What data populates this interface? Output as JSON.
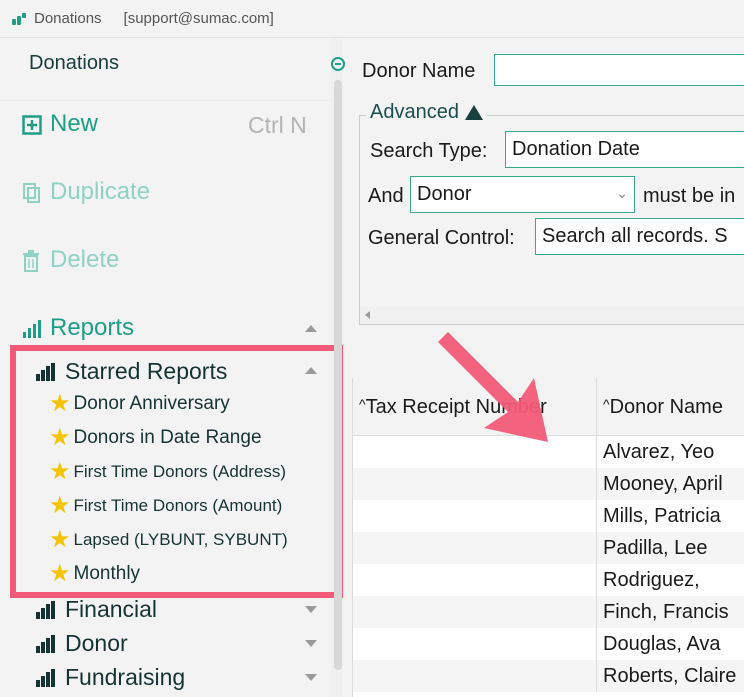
{
  "window": {
    "title": "Donations",
    "account": "[support@sumac.com]"
  },
  "sidebar": {
    "title": "Donations",
    "actions": {
      "new_label": "New",
      "new_shortcut": "Ctrl N",
      "duplicate_label": "Duplicate",
      "delete_label": "Delete",
      "reports_label": "Reports"
    },
    "starred_group": "Starred Reports",
    "starred_reports": [
      "Donor Anniversary",
      "Donors in Date Range",
      "First Time Donors (Address)",
      "First Time Donors (Amount)",
      "Lapsed (LYBUNT, SYBUNT)",
      "Monthly"
    ],
    "report_groups": [
      "Financial",
      "Donor",
      "Fundraising"
    ]
  },
  "search": {
    "donor_name_label": "Donor Name",
    "donor_name_value": "",
    "advanced_label": "Advanced",
    "search_type_label": "Search Type:",
    "search_type_value": "Donation Date",
    "and_label": "And",
    "and_field_value": "Donor",
    "must_be_label": "must be in",
    "general_control_label": "General Control:",
    "general_control_value": "Search all records. S"
  },
  "table": {
    "columns": [
      "Tax Receipt Number",
      "Donor Name"
    ],
    "rows": [
      {
        "receipt": "",
        "donor": "Alvarez, Yeo"
      },
      {
        "receipt": "",
        "donor": "Mooney, April"
      },
      {
        "receipt": "",
        "donor": "Mills, Patricia"
      },
      {
        "receipt": "",
        "donor": "Padilla, Lee"
      },
      {
        "receipt": "",
        "donor": "Rodriguez,"
      },
      {
        "receipt": "",
        "donor": "Finch, Francis"
      },
      {
        "receipt": "",
        "donor": "Douglas, Ava"
      },
      {
        "receipt": "",
        "donor": "Roberts, Claire"
      }
    ]
  },
  "colors": {
    "accent": "#1e9e86",
    "accent_disabled": "#8fd2c3",
    "highlight": "#f25a78",
    "star": "#f5c400"
  }
}
